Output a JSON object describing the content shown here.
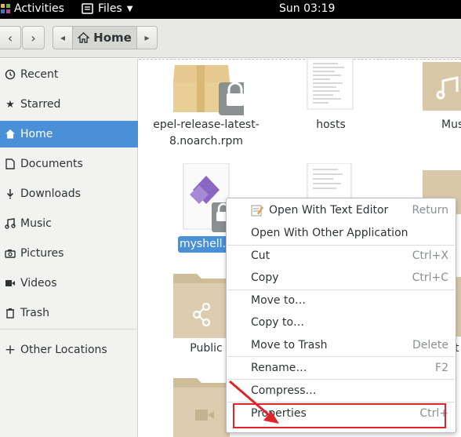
{
  "topbar": {
    "activities": "Activities",
    "app_menu": "Files",
    "clock": "Sun 03:19"
  },
  "pathbar": {
    "current": "Home"
  },
  "sidebar": {
    "items": [
      {
        "label": "Recent",
        "icon": "clock-icon"
      },
      {
        "label": "Starred",
        "icon": "star-icon"
      },
      {
        "label": "Home",
        "icon": "home-icon",
        "active": true
      },
      {
        "label": "Documents",
        "icon": "document-icon"
      },
      {
        "label": "Downloads",
        "icon": "download-icon"
      },
      {
        "label": "Music",
        "icon": "music-icon"
      },
      {
        "label": "Pictures",
        "icon": "camera-icon"
      },
      {
        "label": "Videos",
        "icon": "video-icon"
      },
      {
        "label": "Trash",
        "icon": "trash-icon"
      },
      {
        "label": "Other Locations",
        "icon": "plus-icon"
      }
    ]
  },
  "files": {
    "epel_line1": "epel-release-latest-",
    "epel_line2": "8.noarch.rpm",
    "hosts": "hosts",
    "music": "Mus",
    "myshell": "myshell.s",
    "public": "Public",
    "partial_t": "t"
  },
  "context_menu": {
    "items": [
      {
        "label": "Open With Text Editor",
        "accel": "Return"
      },
      {
        "label": "Open With Other Application",
        "accel": ""
      },
      {
        "label": "Cut",
        "accel": "Ctrl+X"
      },
      {
        "label": "Copy",
        "accel": "Ctrl+C"
      },
      {
        "label": "Move to…",
        "accel": ""
      },
      {
        "label": "Copy to…",
        "accel": ""
      },
      {
        "label": "Move to Trash",
        "accel": "Delete"
      },
      {
        "label": "Rename…",
        "accel": "F2"
      },
      {
        "label": "Compress…",
        "accel": ""
      },
      {
        "label": "Properties",
        "accel": "Ctrl+"
      }
    ]
  },
  "colors": {
    "accent": "#4a90d9",
    "annotation": "#e0242a"
  }
}
